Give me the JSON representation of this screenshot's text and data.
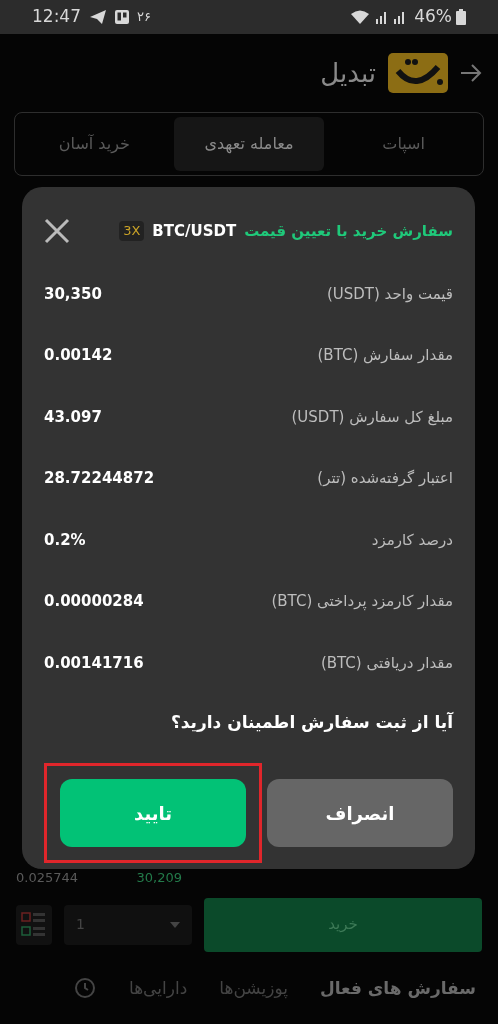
{
  "status_bar": {
    "time": "12:47",
    "notification_count": "۲۶",
    "battery": "46%"
  },
  "header": {
    "title": "تبدیل"
  },
  "tabs": [
    {
      "label": "اسپات",
      "selected": false
    },
    {
      "label": "معامله تعهدی",
      "selected": true
    },
    {
      "label": "خرید آسان",
      "selected": false
    }
  ],
  "background": {
    "order_book_amount": "0.025744",
    "order_book_price": "30,209",
    "quantity_select": "1",
    "buy_button": "خرید"
  },
  "bottom_tabs": [
    {
      "label": "سفارش های فعال",
      "selected": true
    },
    {
      "label": "پوزیشن‌ها",
      "selected": false
    },
    {
      "label": "دارایی‌ها",
      "selected": false
    }
  ],
  "dialog": {
    "title": "سفارش خرید با تعیین قیمت",
    "pair": "BTC/USDT",
    "leverage": "3X",
    "rows": [
      {
        "label": "قیمت واحد (USDT)",
        "value": "30,350"
      },
      {
        "label": "مقدار سفارش (BTC)",
        "value": "0.00142"
      },
      {
        "label": "مبلغ کل سفارش (USDT)",
        "value": "43.097"
      },
      {
        "label": "اعتبار گرفته‌شده (تتر)",
        "value": "28.72244872"
      },
      {
        "label": "درصد کارمزد",
        "value": "0.2%"
      },
      {
        "label": "مقدار کارمزد پرداختی (BTC)",
        "value": "0.00000284"
      },
      {
        "label": "مقدار دریافتی (BTC)",
        "value": "0.00141716"
      }
    ],
    "question": "آیا از ثبت سفارش اطمینان دارید؟",
    "cancel_button": "انصراف",
    "confirm_button": "تایید",
    "confirm_highlighted": true
  }
}
